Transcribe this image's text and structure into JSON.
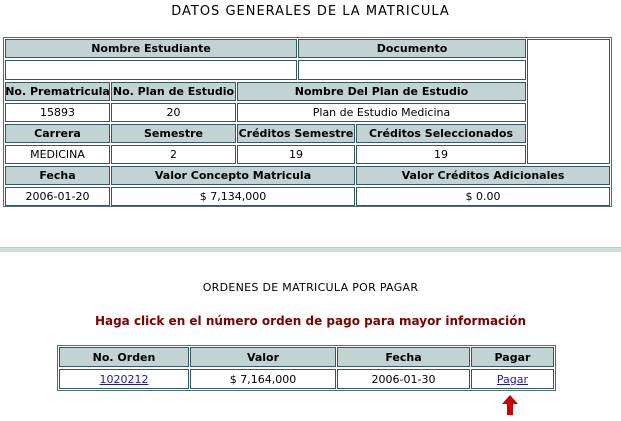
{
  "title": "DATOS GENERALES DE LA MATRICULA",
  "general": {
    "h_nombre": "Nombre Estudiante",
    "h_documento": "Documento",
    "nombre": "",
    "documento": "",
    "h_prematricula": "No. Prematricula",
    "h_plan": "No. Plan de Estudio",
    "h_nombre_plan": "Nombre Del Plan de Estudio",
    "prematricula": "15893",
    "plan": "20",
    "nombre_plan": "Plan de Estudio Medicina",
    "h_carrera": "Carrera",
    "h_semestre": "Semestre",
    "h_creditos_semestre": "Créditos Semestre",
    "h_creditos_sel": "Créditos Seleccionados",
    "carrera": "MEDICINA",
    "semestre": "2",
    "creditos_semestre": "19",
    "creditos_sel": "19",
    "h_fecha": "Fecha",
    "h_valor_concepto": "Valor Concepto Matricula",
    "h_valor_adicionales": "Valor Créditos Adicionales",
    "fecha": "2006-01-20",
    "valor_concepto": "$ 7,134,000",
    "valor_adicionales": "$ 0.00"
  },
  "orders": {
    "title": "ORDENES DE MATRICULA POR PAGAR",
    "hint": "Haga click en el número orden de pago para mayor información",
    "headers": {
      "orden": "No. Orden",
      "valor": "Valor",
      "fecha": "Fecha",
      "pagar": "Pagar"
    },
    "rows": [
      {
        "orden": "1020212",
        "valor": "$ 7,164,000",
        "fecha": "2006-01-30",
        "pagar": "Pagar"
      }
    ]
  },
  "colors": {
    "header_bg": "#c2d3d3",
    "border": "#33595f",
    "hint": "#800000",
    "arrow": "#cc0000",
    "link": "#1a1aa6"
  },
  "icons": {
    "arrow": "arrow-up-icon"
  }
}
